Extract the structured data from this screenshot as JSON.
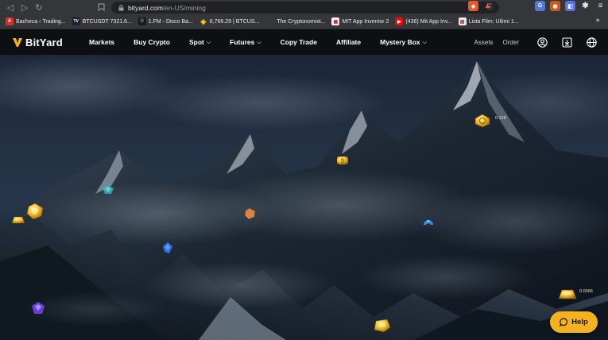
{
  "browser": {
    "url_host": "bityard.com",
    "url_path": "/en-US/mining",
    "bookmarks": [
      {
        "label": "Bacheca ‹ Trading...",
        "color": "#d93025",
        "glyph": "A"
      },
      {
        "label": "BTCUSDT 7321.6...",
        "color": "#1e2230",
        "glyph": "TV"
      },
      {
        "label": "1.FM - Disco Ba...",
        "color": "#1a1a1a",
        "glyph": "D"
      },
      {
        "label": "6,766.29 | BTCUS...",
        "color": "#f0b90b",
        "glyph": "◆"
      },
      {
        "label": "The Cryptonomist...",
        "color": "#35363a",
        "glyph": ""
      },
      {
        "label": "MIT App Inventor 2",
        "color": "#f2f2f2",
        "glyph": "▣"
      },
      {
        "label": "(436) Mit App Inv...",
        "color": "#ff0000",
        "glyph": "▶"
      },
      {
        "label": "Lista Film: Ultimi 1...",
        "color": "#e8eaed",
        "glyph": "▤"
      }
    ]
  },
  "header": {
    "logo_text": "BitYard",
    "nav": [
      {
        "label": "Markets",
        "dropdown": false
      },
      {
        "label": "Buy Crypto",
        "dropdown": false
      },
      {
        "label": "Spot",
        "dropdown": true
      },
      {
        "label": "Futures",
        "dropdown": true
      },
      {
        "label": "Copy Trade",
        "dropdown": false
      },
      {
        "label": "Affiliate",
        "dropdown": false
      },
      {
        "label": "Mystery Box",
        "dropdown": true
      }
    ],
    "assets_label": "Assets",
    "order_label": "Order",
    "accent_color": "#f5b21f"
  },
  "mining": {
    "coin_labels": {
      "peak": "0.128",
      "right": "0.0066"
    }
  },
  "help": {
    "label": "Help"
  }
}
